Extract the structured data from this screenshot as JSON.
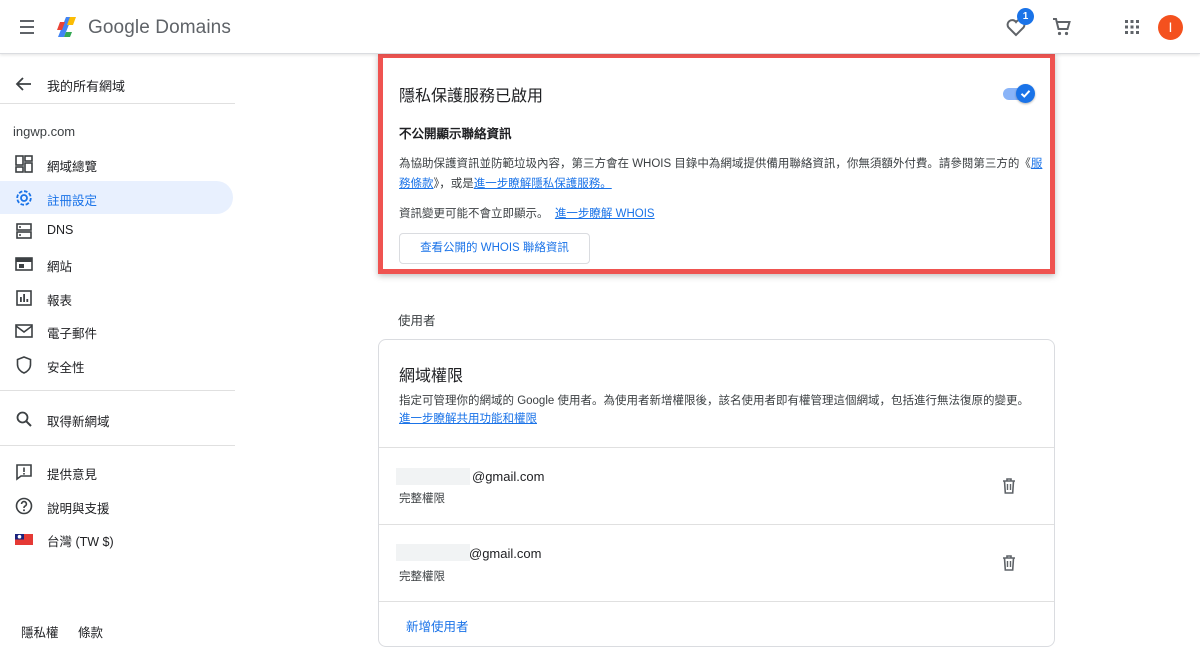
{
  "header": {
    "brand": "Google Domains",
    "favorites_badge": "1",
    "avatar_letter": "I"
  },
  "sidebar": {
    "back_label": "我的所有網域",
    "domain": "ingwp.com",
    "items": [
      {
        "label": "網域總覽",
        "icon": "dashboard-icon"
      },
      {
        "label": "註冊設定",
        "icon": "gear-icon",
        "active": true
      },
      {
        "label": "DNS",
        "icon": "dns-icon"
      },
      {
        "label": "網站",
        "icon": "website-icon"
      },
      {
        "label": "報表",
        "icon": "bar-chart-icon"
      },
      {
        "label": "電子郵件",
        "icon": "mail-icon"
      },
      {
        "label": "安全性",
        "icon": "shield-icon"
      }
    ],
    "get_domain": "取得新網域",
    "feedback": "提供意見",
    "help": "說明與支援",
    "region": "台灣 (TW $)",
    "footer": {
      "privacy": "隱私權",
      "terms": "條款"
    }
  },
  "privacy": {
    "title": "隱私保護服務已啟用",
    "enabled": true,
    "subtitle": "不公開顯示聯絡資訊",
    "desc_1": "為協助保護資訊並防範垃圾內容，第三方會在 WHOIS 目錄中為網域提供備用聯絡資訊，你無須額外付費。請參閱第三方的《",
    "desc_link_1": "服務條款",
    "desc_2": "》，或是",
    "desc_link_2": "進一步瞭解隱私保護服務。",
    "note": "資訊變更可能不會立即顯示。",
    "note_link": "進一步瞭解 WHOIS",
    "button": "查看公開的 WHOIS 聯絡資訊"
  },
  "users": {
    "section_label": "使用者",
    "title": "網域權限",
    "desc": "指定可管理你的網域的 Google 使用者。為使用者新增權限後，該名使用者即有權管理這個網域，包括進行無法復原的變更。",
    "desc_link": "進一步瞭解共用功能和權限",
    "rows": [
      {
        "email": "@gmail.com",
        "role": "完整權限"
      },
      {
        "email": "@gmail.com",
        "role": "完整權限"
      }
    ],
    "add_user": "新增使用者"
  },
  "colors": {
    "accent": "#1a73e8",
    "highlight_border": "#ef5350",
    "active_nav_bg": "#e8f0fe",
    "avatar_bg": "#f4511e"
  }
}
